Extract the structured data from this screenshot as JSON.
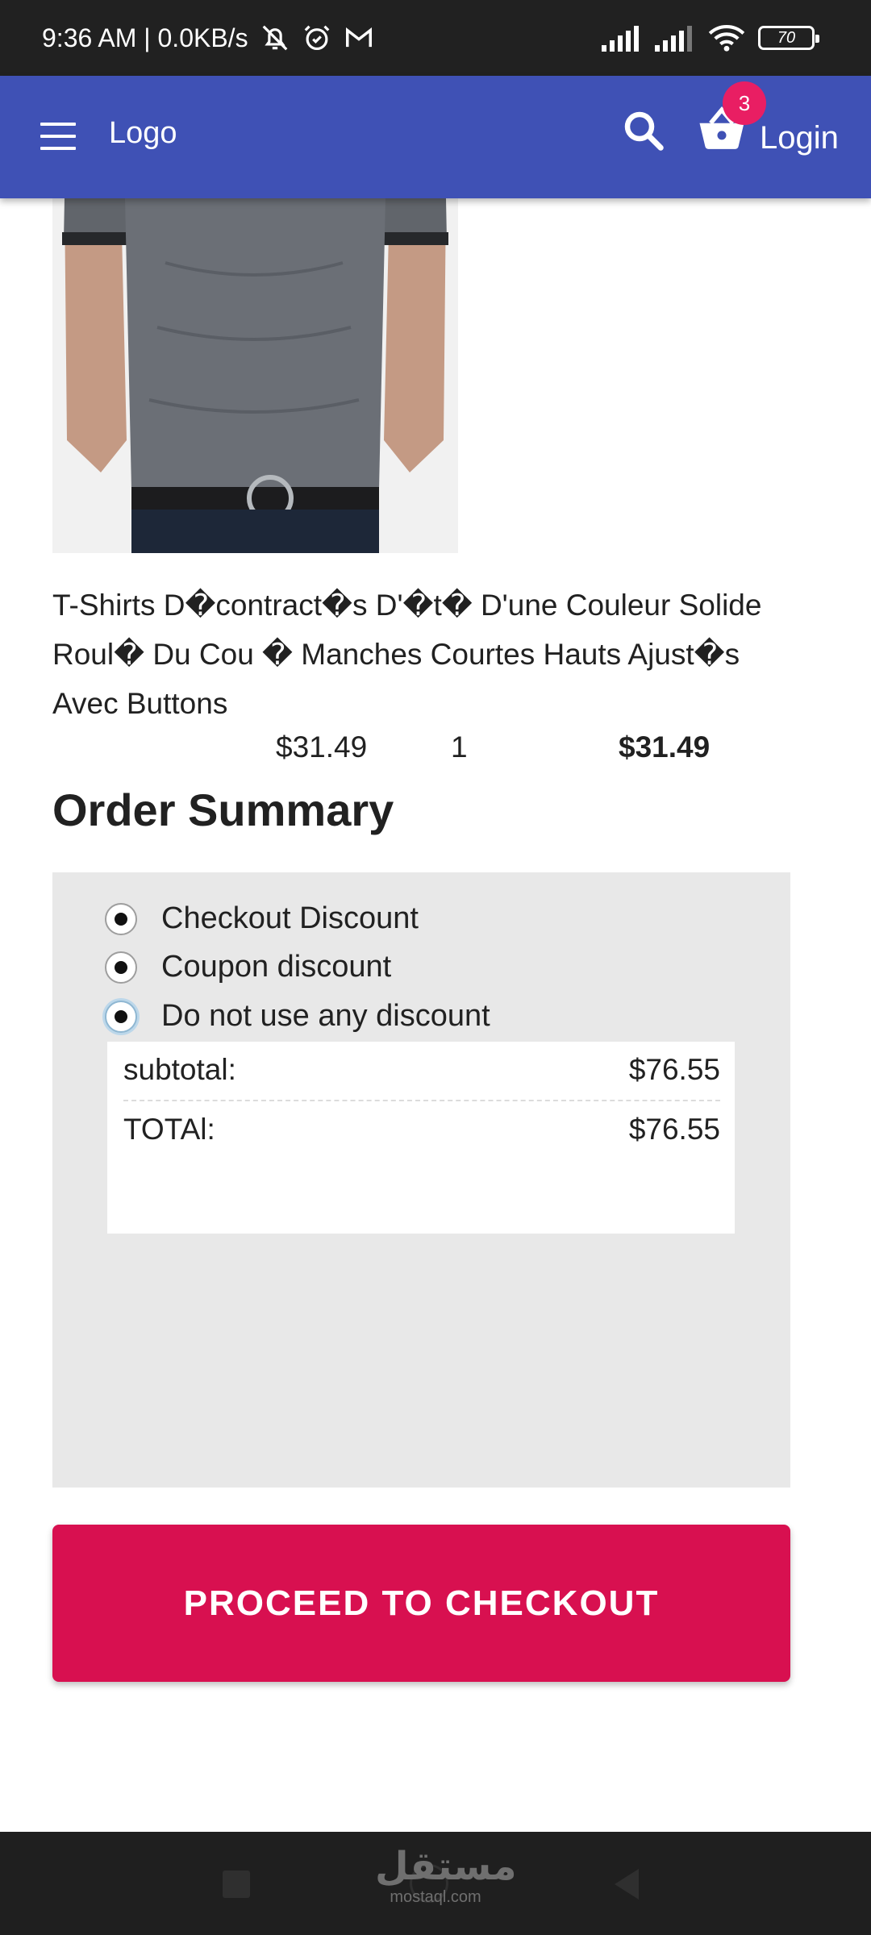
{
  "status_bar": {
    "time_info": "9:36 AM | 0.0KB/s",
    "battery": "70"
  },
  "header": {
    "logo": "Logo",
    "cart_count": "3",
    "login_label": "Login"
  },
  "product": {
    "title": "T-Shirts D�contract�s D'�t� D'une Couleur Solide Roul� Du Cou � Manches Courtes Hauts Ajust�s Avec Buttons",
    "price": "$31.49",
    "quantity": "1",
    "line_total": "$31.49"
  },
  "order_summary": {
    "title": "Order Summary",
    "discount_options": [
      {
        "label": "Checkout Discount",
        "selected": true
      },
      {
        "label": "Coupon discount",
        "selected": true
      },
      {
        "label": "Do not use any discount",
        "selected": true
      }
    ],
    "subtotal_label": "subtotal:",
    "subtotal_value": "$76.55",
    "total_label": "TOTAl:",
    "total_value": "$76.55"
  },
  "checkout_button": "PROCEED TO CHECKOUT",
  "watermark": {
    "arabic": "مستقل",
    "latin": "mostaql.com"
  },
  "colors": {
    "app_bar": "#3f51b5",
    "badge": "#e91e63",
    "checkout": "#d81050",
    "panel": "#e8e8e8"
  }
}
